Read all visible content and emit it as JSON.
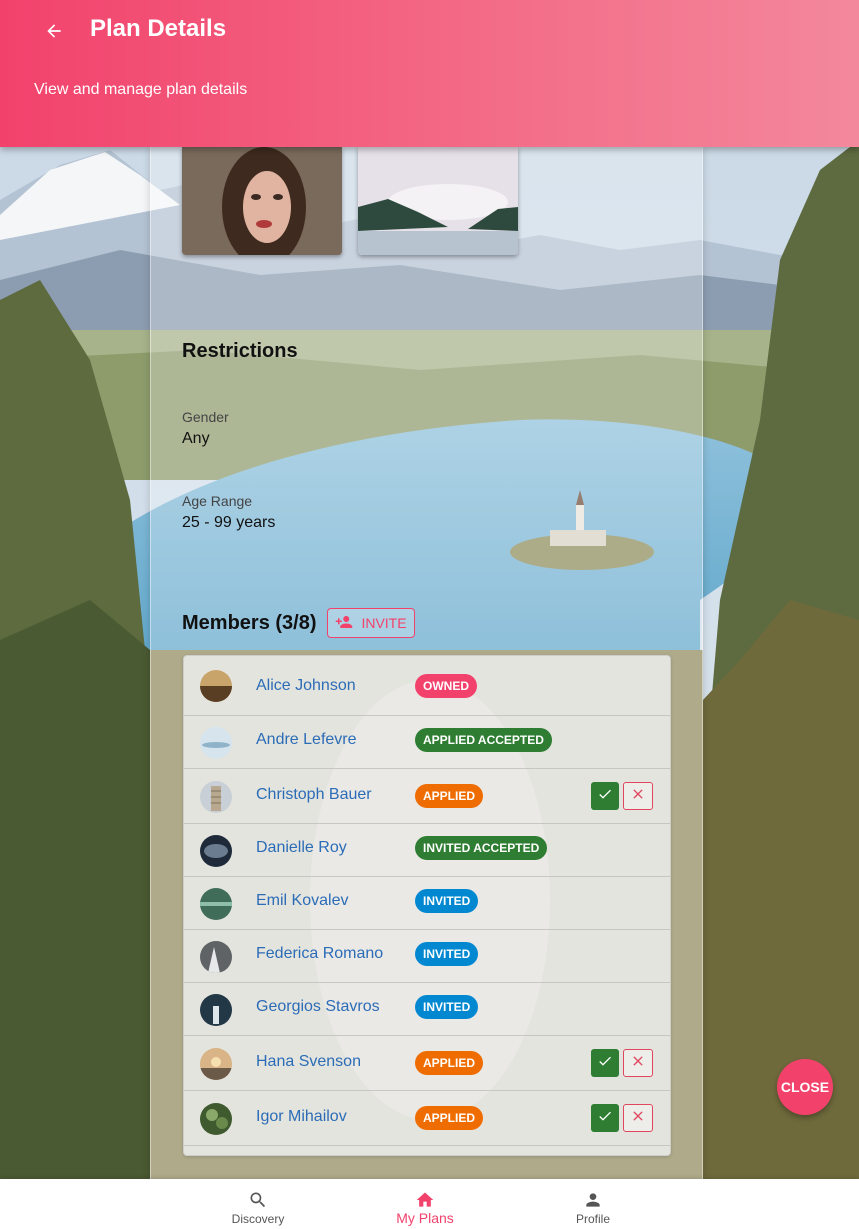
{
  "header": {
    "title": "Plan Details",
    "subtitle": "View and manage plan details",
    "back_icon": "arrow-back-icon",
    "gradient_start": "#f2426c",
    "gradient_end": "#f3889c"
  },
  "restrictions": {
    "heading": "Restrictions",
    "gender_label": "Gender",
    "gender_value": "Any",
    "age_label": "Age Range",
    "age_value": "25 - 99 years"
  },
  "members": {
    "heading": "Members (3/8)",
    "invite_label": "INVITE",
    "invite_icon": "person-add-icon",
    "list": [
      {
        "name": "Alice Johnson",
        "status": "OWNED",
        "status_color": "#f2426c",
        "actions": false
      },
      {
        "name": "Andre Lefevre",
        "status": "APPLIED ACCEPTED",
        "status_color": "#2e7d32",
        "actions": false
      },
      {
        "name": "Christoph Bauer",
        "status": "APPLIED",
        "status_color": "#ef6c00",
        "actions": true
      },
      {
        "name": "Danielle Roy",
        "status": "INVITED ACCEPTED",
        "status_color": "#2e7d32",
        "actions": false
      },
      {
        "name": "Emil Kovalev",
        "status": "INVITED",
        "status_color": "#0288d1",
        "actions": false
      },
      {
        "name": "Federica Romano",
        "status": "INVITED",
        "status_color": "#0288d1",
        "actions": false
      },
      {
        "name": "Georgios Stavros",
        "status": "INVITED",
        "status_color": "#0288d1",
        "actions": false
      },
      {
        "name": "Hana Svenson",
        "status": "APPLIED",
        "status_color": "#ef6c00",
        "actions": true
      },
      {
        "name": "Igor Mihailov",
        "status": "APPLIED",
        "status_color": "#ef6c00",
        "actions": true
      }
    ]
  },
  "close_label": "CLOSE",
  "nav": {
    "items": [
      {
        "label": "Discovery",
        "icon": "search-icon"
      },
      {
        "label": "My Plans",
        "icon": "home-icon",
        "active": true
      },
      {
        "label": "Profile",
        "icon": "person-icon"
      }
    ]
  },
  "colors": {
    "accent": "#f2426c",
    "link": "#2b6cb7"
  }
}
